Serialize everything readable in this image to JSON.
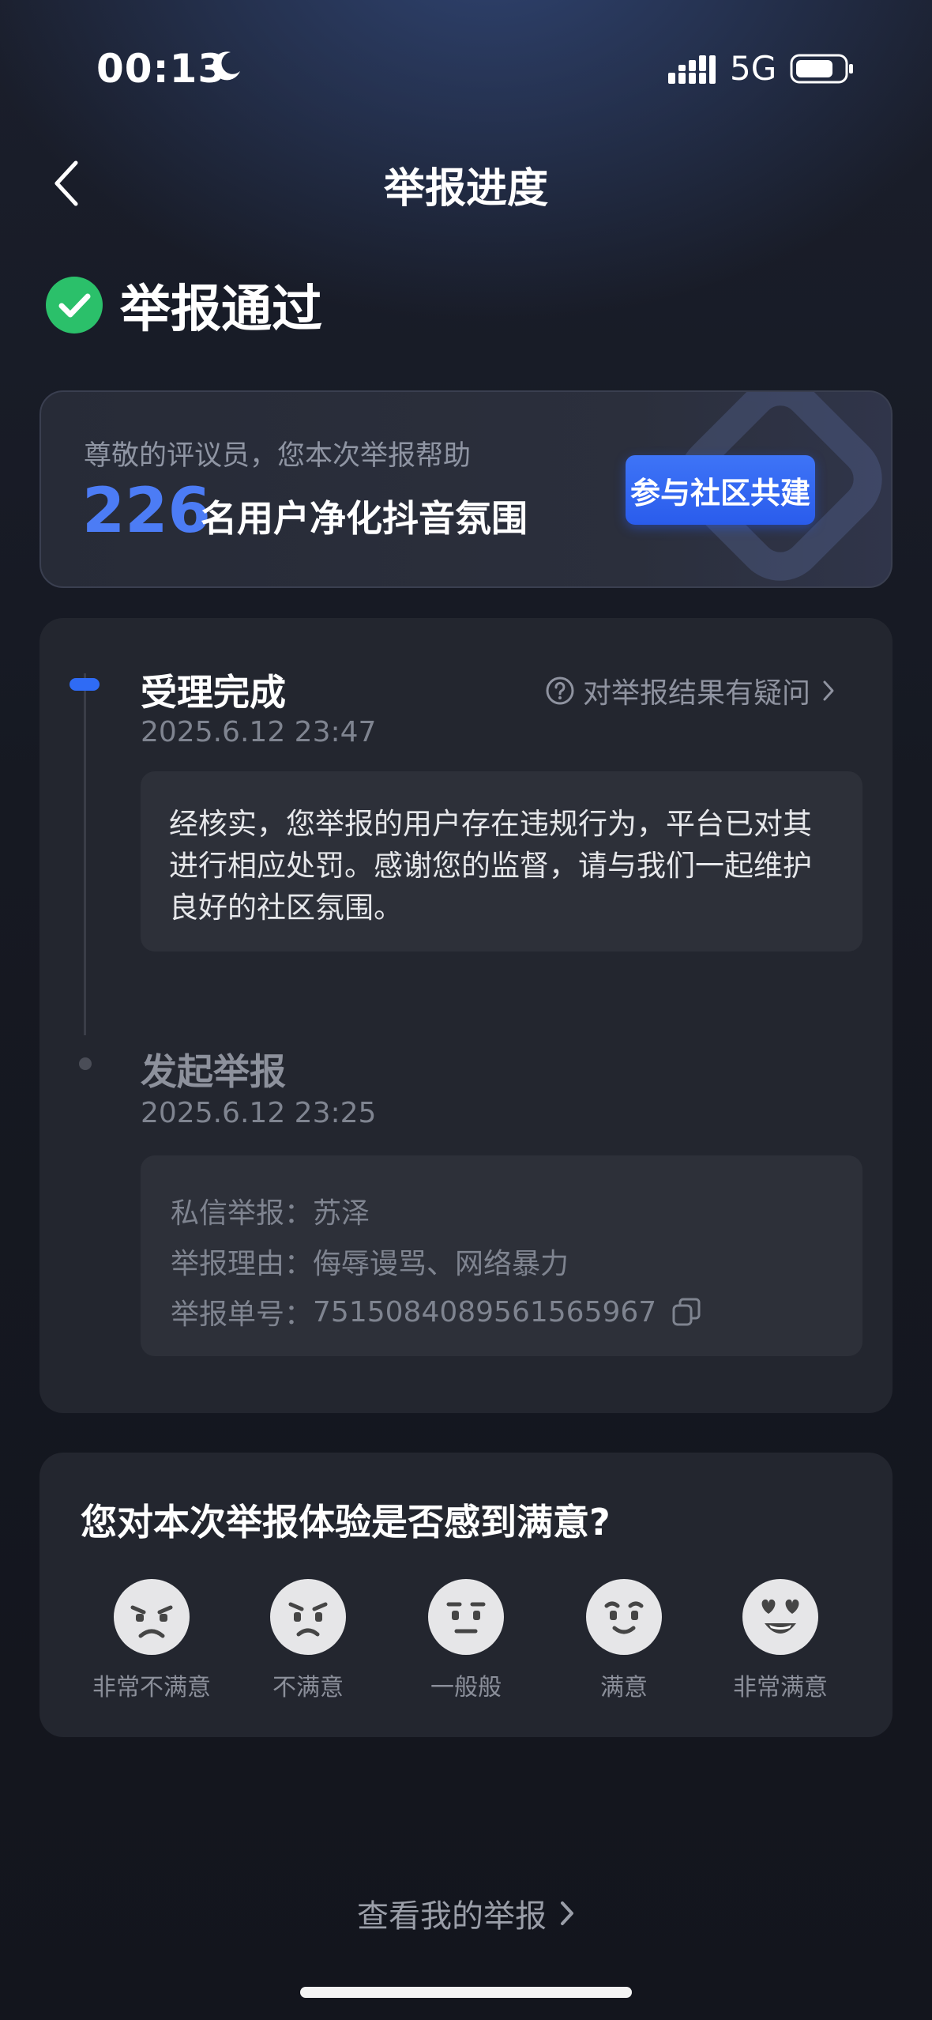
{
  "status_bar": {
    "time": "00:13",
    "network": "5G",
    "icons": [
      "moon-icon",
      "signal-icon",
      "battery-icon"
    ]
  },
  "nav": {
    "title": "举报进度",
    "back_icon": "chevron-left-icon"
  },
  "report_status": {
    "label": "举报通过",
    "icon": "check-circle-icon",
    "color": "#2bc06a"
  },
  "banner": {
    "subtitle": "尊敬的评议员，您本次举报帮助",
    "count": "226",
    "text": "名用户净化抖音氛围",
    "button_label": "参与社区共建",
    "accent_color": "#4c7cf5"
  },
  "timeline": {
    "steps": [
      {
        "title": "受理完成",
        "time": "2025.6.12 23:47",
        "description": "经核实，您举报的用户存在违规行为，平台已对其进行相应处罚。感谢您的监督，请与我们一起维护良好的社区氛围。",
        "state": "active"
      },
      {
        "title": "发起举报",
        "time": "2025.6.12 23:25",
        "details": [
          {
            "label": "私信举报：",
            "value": "苏泽"
          },
          {
            "label": "举报理由：",
            "value": "侮辱谩骂、网络暴力"
          },
          {
            "label": "举报单号：",
            "value": "7515084089561565967"
          }
        ],
        "state": "done"
      }
    ],
    "query_link": "对举报结果有疑问",
    "active_color": "#2f6bf5"
  },
  "survey": {
    "question": "您对本次举报体验是否感到满意?",
    "options": [
      {
        "label": "非常不满意",
        "icon": "very-dissatisfied-face-icon"
      },
      {
        "label": "不满意",
        "icon": "dissatisfied-face-icon"
      },
      {
        "label": "一般般",
        "icon": "neutral-face-icon"
      },
      {
        "label": "满意",
        "icon": "satisfied-face-icon"
      },
      {
        "label": "非常满意",
        "icon": "very-satisfied-face-icon"
      }
    ]
  },
  "footer": {
    "link": "查看我的举报"
  }
}
